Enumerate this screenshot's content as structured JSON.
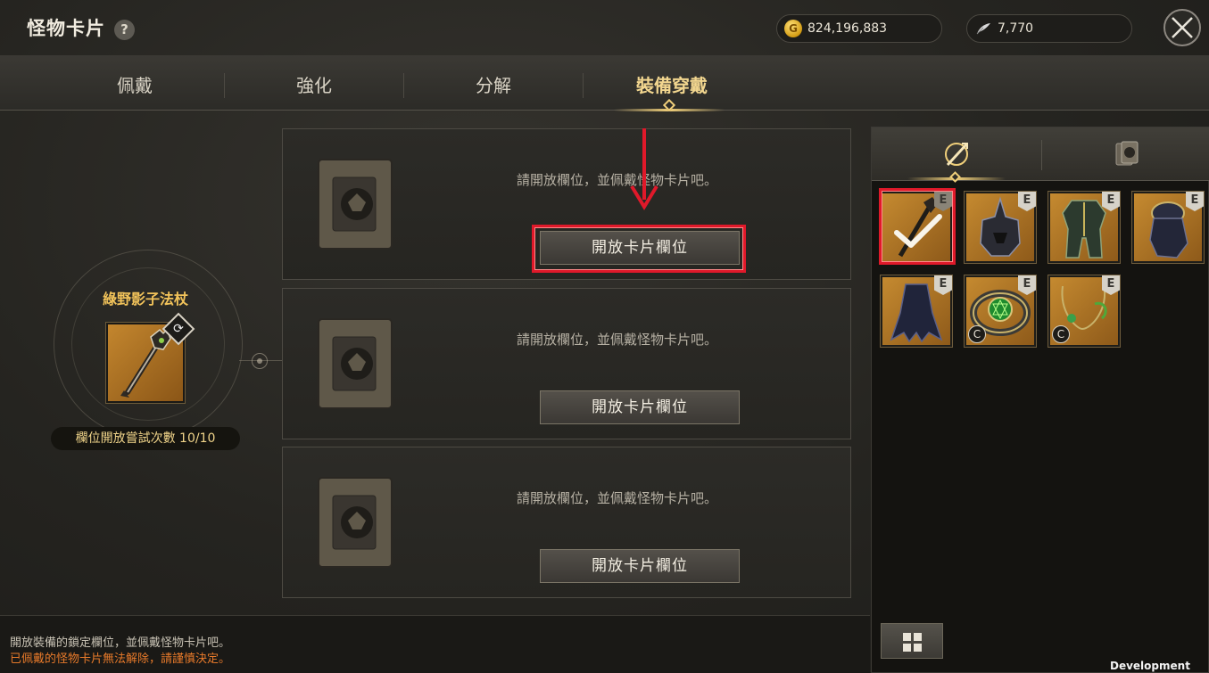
{
  "header": {
    "title": "怪物卡片",
    "help_label": "?",
    "gold_amount": "824,196,883",
    "silver_amount": "7,770"
  },
  "tabs": [
    {
      "label": "佩戴",
      "active": false
    },
    {
      "label": "強化",
      "active": false
    },
    {
      "label": "分解",
      "active": false
    },
    {
      "label": "裝備穿戴",
      "active": true
    }
  ],
  "equipment": {
    "name": "綠野影子法杖",
    "tries_label": "欄位開放嘗試次數 10/10"
  },
  "slots": [
    {
      "message": "請開放欄位，並佩戴怪物卡片吧。",
      "button_label": "開放卡片欄位"
    },
    {
      "message": "請開放欄位，並佩戴怪物卡片吧。",
      "button_label": "開放卡片欄位"
    },
    {
      "message": "請開放欄位，並佩戴怪物卡片吧。",
      "button_label": "開放卡片欄位"
    }
  ],
  "footer": {
    "note": "開放裝備的鎖定欄位，並佩戴怪物卡片吧。",
    "warning": "已佩戴的怪物卡片無法解除，請謹慎決定。"
  },
  "inventory": {
    "items": [
      {
        "name": "staff",
        "badge": "E",
        "selected": true,
        "icon": "staff-icon"
      },
      {
        "name": "helmet",
        "badge": "E",
        "icon": "helmet-icon"
      },
      {
        "name": "armor",
        "badge": "E",
        "icon": "armor-icon"
      },
      {
        "name": "gloves",
        "badge": "E",
        "icon": "gloves-icon"
      },
      {
        "name": "cape",
        "badge": "E",
        "icon": "cape-icon"
      },
      {
        "name": "ring",
        "badge": "E",
        "corner": "C",
        "icon": "ring-icon"
      },
      {
        "name": "necklace",
        "badge": "E",
        "corner": "C",
        "icon": "necklace-icon"
      }
    ]
  },
  "dev_label": "Development Build",
  "colors": {
    "highlight": "#e0192a",
    "accent": "#f0cf7a",
    "warning": "#e87a2a",
    "name": "#f2c35a"
  }
}
